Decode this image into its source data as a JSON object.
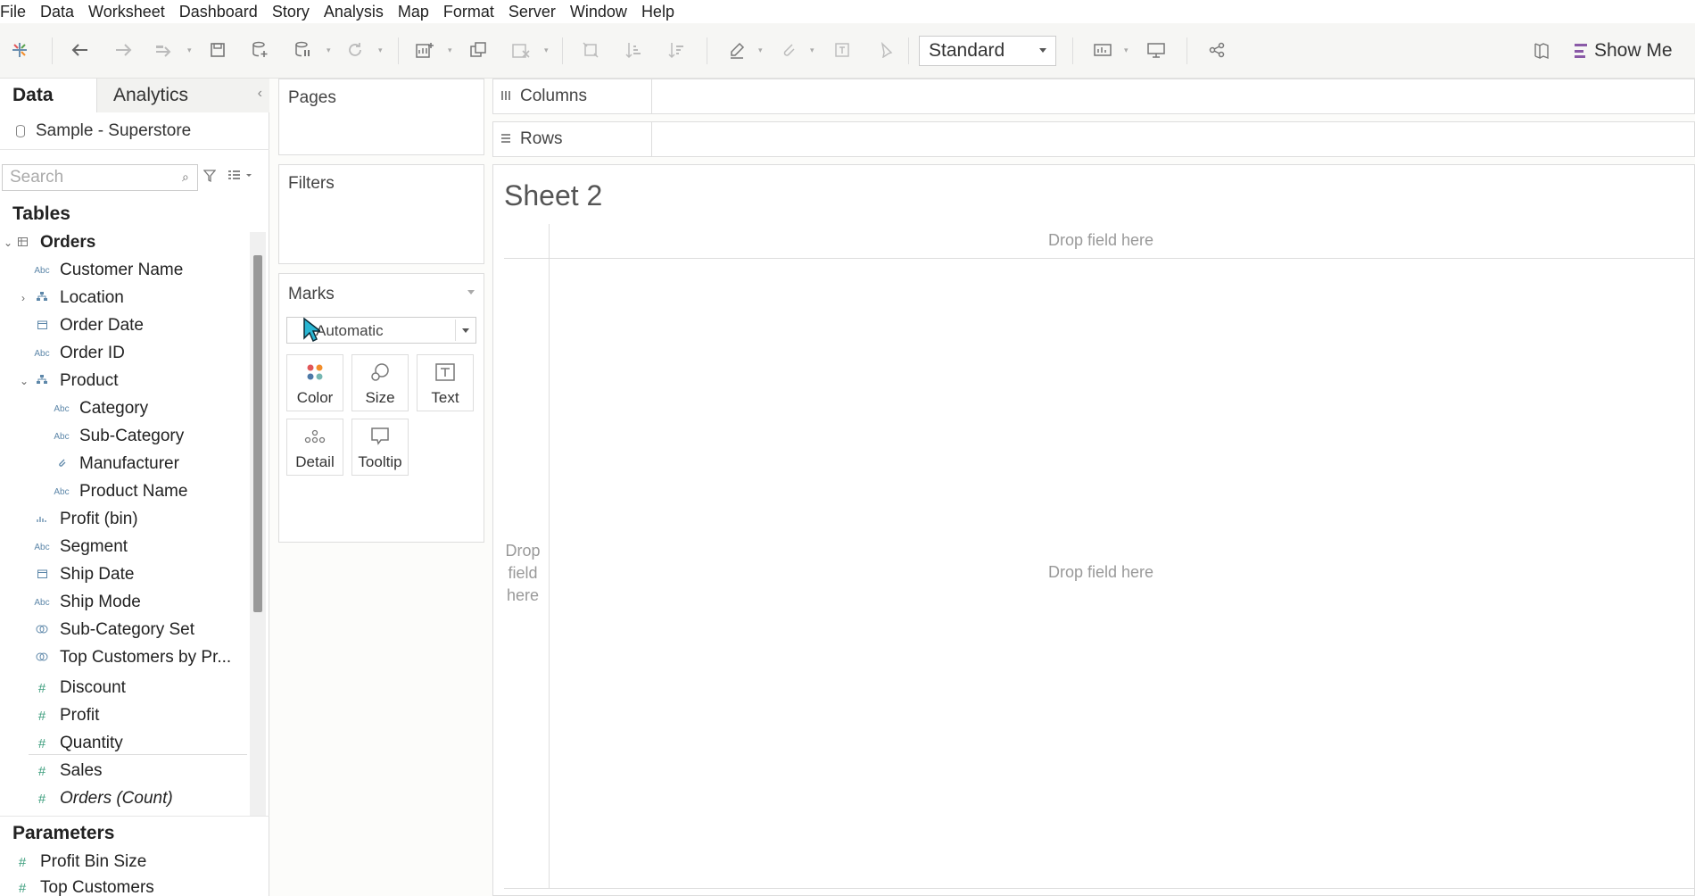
{
  "menu": [
    "File",
    "Data",
    "Worksheet",
    "Dashboard",
    "Story",
    "Analysis",
    "Map",
    "Format",
    "Server",
    "Window",
    "Help"
  ],
  "toolbar": {
    "fit_value": "Standard",
    "show_me_label": "Show Me",
    "showme_color": "#8a5aa7"
  },
  "datapane": {
    "tab_data": "Data",
    "tab_analytics": "Analytics",
    "datasource": "Sample - Superstore",
    "search_placeholder": "Search",
    "tables_heading": "Tables",
    "parameters_heading": "Parameters",
    "fields": [
      {
        "label": "Orders",
        "icon": "table-icon"
      },
      {
        "label": "Customer Name",
        "icon": "abc"
      },
      {
        "label": "Location",
        "icon": "hierarchy-icon"
      },
      {
        "label": "Order Date",
        "icon": "calendar-icon"
      },
      {
        "label": "Order ID",
        "icon": "abc"
      },
      {
        "label": "Product",
        "icon": "hierarchy-icon"
      },
      {
        "label": "Category",
        "icon": "abc"
      },
      {
        "label": "Sub-Category",
        "icon": "abc"
      },
      {
        "label": "Manufacturer",
        "icon": "group-icon"
      },
      {
        "label": "Product Name",
        "icon": "abc"
      },
      {
        "label": "Profit (bin)",
        "icon": "bin-icon"
      },
      {
        "label": "Segment",
        "icon": "abc"
      },
      {
        "label": "Ship Date",
        "icon": "calendar-icon"
      },
      {
        "label": "Ship Mode",
        "icon": "abc"
      },
      {
        "label": "Sub-Category Set",
        "icon": "set-icon"
      },
      {
        "label": "Top Customers by Pr...",
        "icon": "set-icon"
      },
      {
        "label": "Discount",
        "icon": "measure-icon"
      },
      {
        "label": "Profit",
        "icon": "measure-icon"
      },
      {
        "label": "Quantity",
        "icon": "measure-icon"
      },
      {
        "label": "Sales",
        "icon": "measure-icon"
      },
      {
        "label": "Orders (Count)",
        "icon": "measure-icon"
      }
    ],
    "parameters": [
      {
        "label": "Profit Bin Size",
        "icon": "measure-icon"
      },
      {
        "label": "Top Customers",
        "icon": "measure-icon"
      }
    ],
    "abc_glyph": "Abc",
    "measure_glyph": "#"
  },
  "cards": {
    "pages": "Pages",
    "filters": "Filters",
    "marks": "Marks",
    "mark_type": "Automatic",
    "buttons": [
      "Color",
      "Size",
      "Text",
      "Detail",
      "Tooltip"
    ]
  },
  "shelves": {
    "columns": "Columns",
    "rows": "Rows"
  },
  "view": {
    "sheet_title": "Sheet 2",
    "drop_columns": "Drop field here",
    "drop_rows_line1": "Drop",
    "drop_rows_line2": "field",
    "drop_rows_line3": "here",
    "drop_main": "Drop field here"
  },
  "colors": {
    "accent_blue": "#5d87a9",
    "measure_green": "#3b9d7c",
    "cursor_cyan": "#29b6d3",
    "color_dot_1": "#e15759",
    "color_dot_2": "#f28e2b",
    "color_dot_3": "#4e79a7",
    "color_dot_4": "#76b7b2"
  }
}
